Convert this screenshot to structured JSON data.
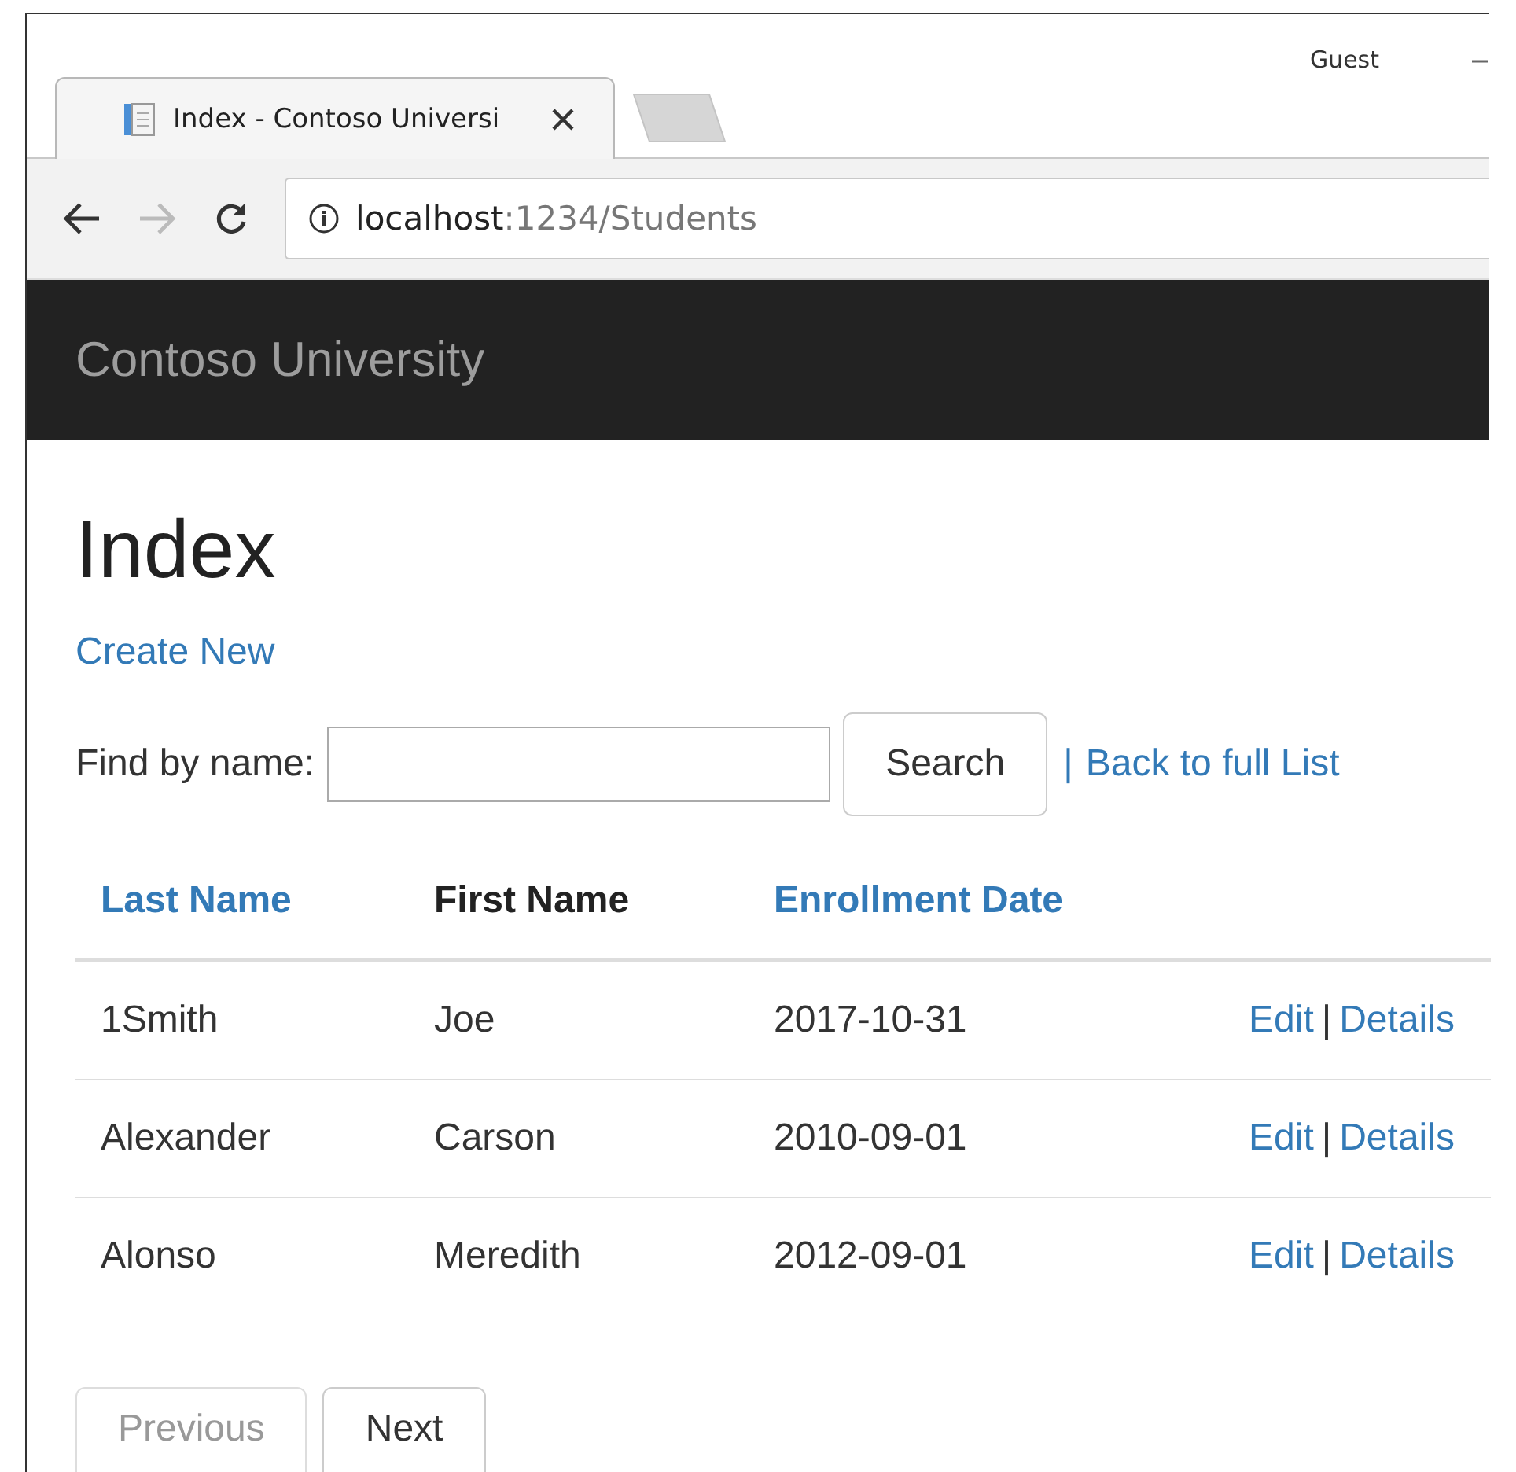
{
  "browser": {
    "tab_title": "Index - Contoso Universi",
    "profile": "Guest",
    "address": {
      "host": "localhost",
      "rest": ":1234/Students"
    }
  },
  "navbar": {
    "brand": "Contoso University"
  },
  "page": {
    "heading": "Index",
    "create_link": "Create New",
    "search": {
      "label": "Find by name:",
      "button": "Search",
      "separator": "|",
      "back_link": "Back to full List"
    }
  },
  "table": {
    "columns": [
      {
        "label": "Last Name",
        "kind": "link"
      },
      {
        "label": "First Name",
        "kind": "text"
      },
      {
        "label": "Enrollment Date",
        "kind": "link"
      }
    ],
    "rows": [
      {
        "cells": [
          "1Smith",
          "Joe",
          "2017-10-31"
        ],
        "actions": [
          "Edit",
          "Details"
        ],
        "separator": "|"
      },
      {
        "cells": [
          "Alexander",
          "Carson",
          "2010-09-01"
        ],
        "actions": [
          "Edit",
          "Details"
        ],
        "separator": "|"
      },
      {
        "cells": [
          "Alonso",
          "Meredith",
          "2012-09-01"
        ],
        "actions": [
          "Edit",
          "Details"
        ],
        "separator": "|"
      }
    ]
  },
  "pager": [
    {
      "label": "Previous",
      "disabled": true
    },
    {
      "label": "Next",
      "disabled": false
    }
  ]
}
